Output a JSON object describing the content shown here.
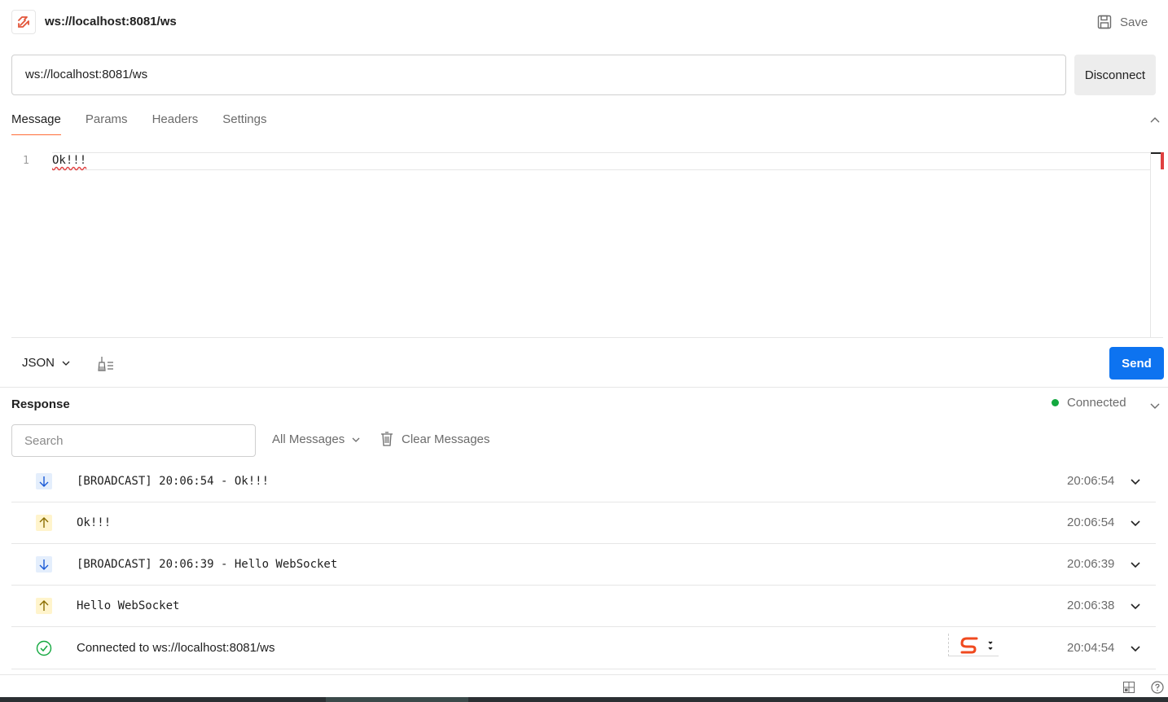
{
  "header": {
    "title": "ws://localhost:8081/ws",
    "save_label": "Save"
  },
  "request": {
    "url": "ws://localhost:8081/ws",
    "disconnect_label": "Disconnect"
  },
  "tabs": [
    {
      "label": "Message",
      "active": true
    },
    {
      "label": "Params",
      "active": false
    },
    {
      "label": "Headers",
      "active": false
    },
    {
      "label": "Settings",
      "active": false
    }
  ],
  "editor": {
    "line_number": "1",
    "content": "Ok!!!"
  },
  "editor_toolbar": {
    "format": "JSON",
    "send_label": "Send"
  },
  "response": {
    "title": "Response",
    "status": "Connected",
    "search_placeholder": "Search",
    "filter": "All Messages",
    "clear_label": "Clear Messages",
    "messages": [
      {
        "direction": "incoming",
        "text": "[BROADCAST] 20:06:54 - Ok!!!",
        "time": "20:06:54"
      },
      {
        "direction": "outgoing",
        "text": "Ok!!!",
        "time": "20:06:54"
      },
      {
        "direction": "incoming",
        "text": "[BROADCAST] 20:06:39 - Hello WebSocket",
        "time": "20:06:39"
      },
      {
        "direction": "outgoing",
        "text": "Hello WebSocket",
        "time": "20:06:38"
      },
      {
        "direction": "connected",
        "text": "Connected to ws://localhost:8081/ws",
        "time": "20:04:54"
      }
    ]
  },
  "colors": {
    "accent": "#ff6c37",
    "send": "#0d73f0",
    "connected": "#13a83f",
    "incoming_bg": "#e4eefc",
    "outgoing_bg": "#fff4cc"
  }
}
